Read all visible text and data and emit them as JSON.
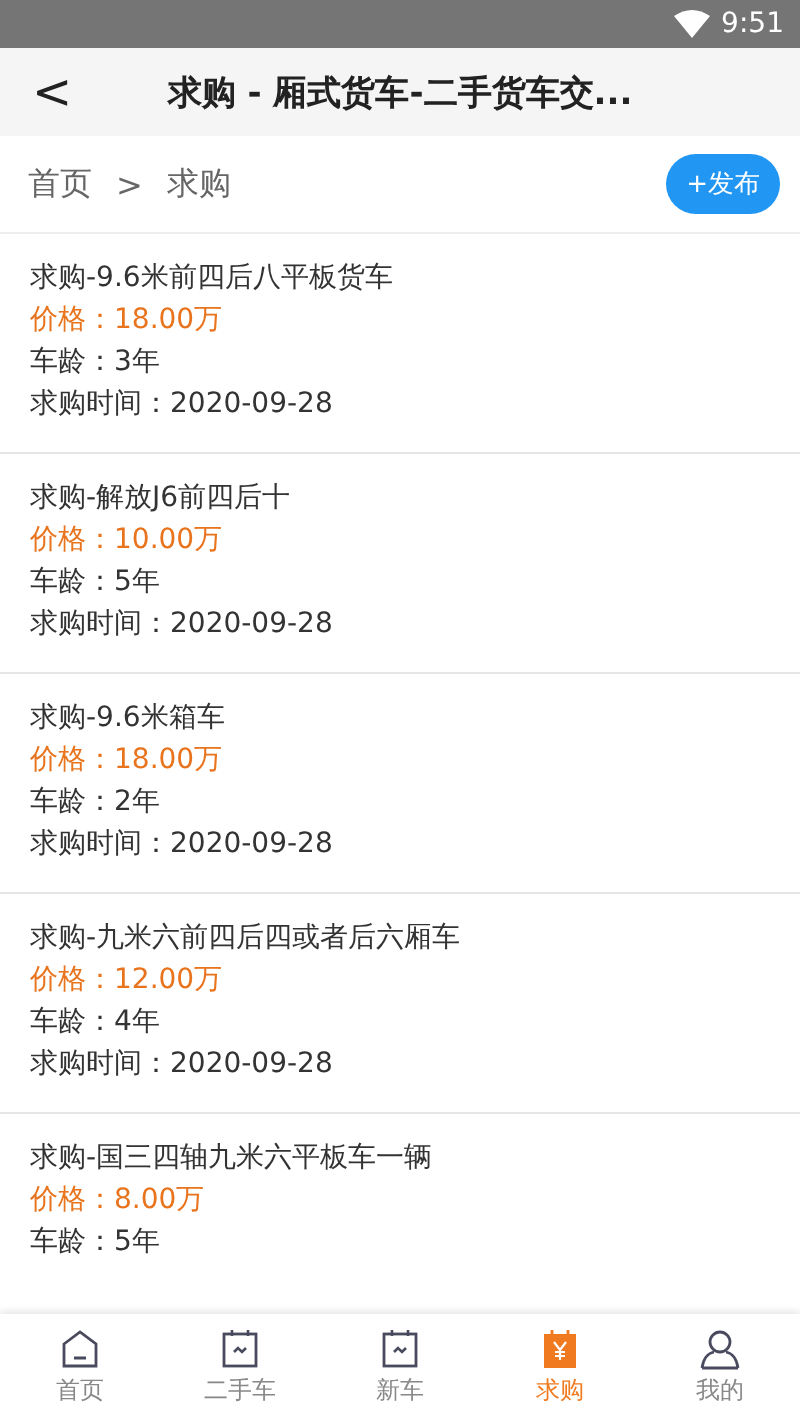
{
  "status_bar": {
    "time": "9:51"
  },
  "header": {
    "back": "<",
    "title": "求购 - 厢式货车-二手货车交..."
  },
  "breadcrumb": {
    "items": [
      "首页",
      "求购"
    ],
    "separator": ">",
    "publish_button": "+发布"
  },
  "listings": [
    {
      "title": "求购-9.6米前四后八平板货车",
      "price": "价格：18.00万",
      "age": "车龄：3年",
      "time": "求购时间：2020-09-28"
    },
    {
      "title": "求购-解放J6前四后十",
      "price": "价格：10.00万",
      "age": "车龄：5年",
      "time": "求购时间：2020-09-28"
    },
    {
      "title": "求购-9.6米箱车",
      "price": "价格：18.00万",
      "age": "车龄：2年",
      "time": "求购时间：2020-09-28"
    },
    {
      "title": "求购-九米六前四后四或者后六厢车",
      "price": "价格：12.00万",
      "age": "车龄：4年",
      "time": "求购时间：2020-09-28"
    },
    {
      "title": "求购-国三四轴九米六平板车一辆",
      "price": "价格：8.00万",
      "age": "车龄：5年"
    }
  ],
  "tabs": [
    {
      "label": "首页",
      "kind": "home",
      "selected": false
    },
    {
      "label": "二手车",
      "kind": "calendar",
      "selected": false
    },
    {
      "label": "新车",
      "kind": "calendar",
      "selected": false
    },
    {
      "label": "求购",
      "kind": "yen",
      "selected": true
    },
    {
      "label": "我的",
      "kind": "person",
      "selected": false
    }
  ]
}
